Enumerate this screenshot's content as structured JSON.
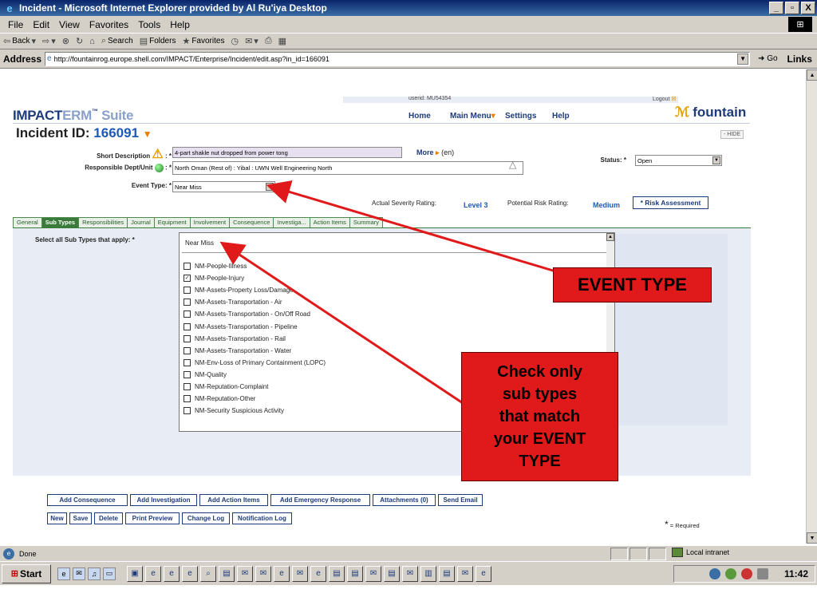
{
  "window": {
    "title": "Incident - Microsoft Internet Explorer provided by Al Ru'iya Desktop",
    "minimize": "_",
    "restore": "▫",
    "close": "X"
  },
  "menubar": {
    "items": [
      "File",
      "Edit",
      "View",
      "Favorites",
      "Tools",
      "Help"
    ]
  },
  "toolbar": {
    "back": "Back",
    "search": "Search",
    "folders": "Folders",
    "favorites": "Favorites"
  },
  "address": {
    "label": "Address",
    "url": "http://fountainrog.europe.shell.com/IMPACT/Enterprise/Incident/edit.asp?in_id=166091",
    "go": "Go",
    "links": "Links"
  },
  "app": {
    "logo_main": "IMPACT",
    "logo_erm": "ERM",
    "logo_tm": "™",
    "logo_suite": "Suite",
    "userid": "userid: MU54354",
    "logout": "Logout",
    "nav": {
      "home": "Home",
      "main_menu": "Main Menu",
      "settings": "Settings",
      "help": "Help"
    },
    "brand": "fountain",
    "brand_icon": "fountain-logo-icon"
  },
  "incident": {
    "title_label": "Incident ID:",
    "id": "166091",
    "hide": "- HIDE",
    "short_desc_label": "Short Description",
    "short_desc_suffix": ": *",
    "short_desc_value": "4-part shakle nut dropped from power tong",
    "more_link": "More",
    "more_lang": "(en)",
    "resp_label": "Responsible Dept/Unit",
    "resp_suffix": ": *",
    "resp_value": "North Oman (Rest of) : Yibal : UWN Well Engineering North",
    "status_label": "Status: *",
    "status_value": "Open",
    "event_type_label": "Event Type: *",
    "event_type_value": "Near Miss",
    "actual_severity_label": "Actual Severity Rating:",
    "actual_severity_value": "Level 3",
    "potential_risk_label": "Potential Risk Rating:",
    "potential_risk_value": "Medium",
    "risk_assessment_button": "* Risk Assessment"
  },
  "tabs": [
    "General",
    "Sub Types",
    "Responsibilities",
    "Journal",
    "Equipment",
    "Involvement",
    "Consequence",
    "Investiga...",
    "Action Items",
    "Summary"
  ],
  "active_tab": "Sub Types",
  "subtypes": {
    "label": "Select all Sub Types that apply: *",
    "header": "Near Miss",
    "items": [
      {
        "label": "NM-People-Illness",
        "checked": false
      },
      {
        "label": "NM-People-Injury",
        "checked": true
      },
      {
        "label": "NM-Assets-Property Loss/Damage",
        "checked": false
      },
      {
        "label": "NM-Assets-Transportation - Air",
        "checked": false
      },
      {
        "label": "NM-Assets-Transportation - On/Off Road",
        "checked": false
      },
      {
        "label": "NM-Assets-Transportation - Pipeline",
        "checked": false
      },
      {
        "label": "NM-Assets-Transportation - Rail",
        "checked": false
      },
      {
        "label": "NM-Assets-Transportation - Water",
        "checked": false
      },
      {
        "label": "NM-Env-Loss of Primary Containment (LOPC)",
        "checked": false
      },
      {
        "label": "NM-Quality",
        "checked": false
      },
      {
        "label": "NM-Reputation-Complaint",
        "checked": false
      },
      {
        "label": "NM-Reputation-Other",
        "checked": false
      },
      {
        "label": "NM-Security Suspicious Activity",
        "checked": false
      }
    ]
  },
  "action_buttons_row1": [
    "Add Consequence",
    "Add Investigation",
    "Add Action Items",
    "Add Emergency Response",
    "Attachments (0)",
    "Send Email"
  ],
  "action_buttons_row2": [
    "New",
    "Save",
    "Delete",
    "Print Preview",
    "Change Log",
    "Notification Log"
  ],
  "required_note": "= Required",
  "required_star": "*",
  "statusbar": {
    "text": "Done",
    "zone": "Local intranet"
  },
  "taskbar": {
    "start": "Start",
    "clock": "11:42"
  },
  "annotations": {
    "event_type": "EVENT TYPE",
    "check_subtypes": "Check only\nsub types\nthat match\nyour EVENT\nTYPE",
    "color": "#e01a1a"
  }
}
